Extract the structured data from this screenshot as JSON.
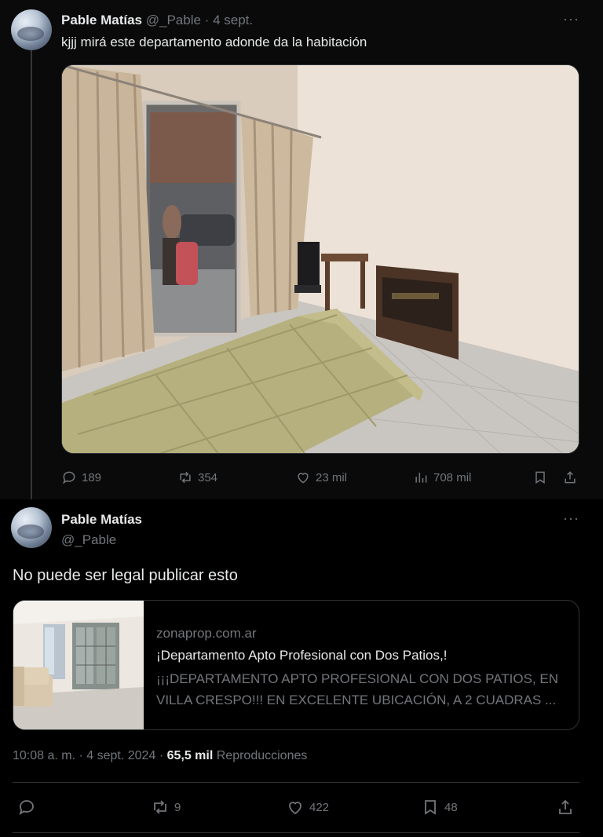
{
  "reply": {
    "author_name": "Pable Matías",
    "author_handle": "@_Pable",
    "separator": "·",
    "date": "4 sept.",
    "more": "···",
    "text": "kjjj mirá este departamento adonde da la habitación",
    "stats": {
      "replies": "189",
      "reposts": "354",
      "likes": "23 mil",
      "views": "708 mil"
    }
  },
  "main": {
    "author_name": "Pable Matías",
    "author_handle": "@_Pable",
    "more": "···",
    "text": "No puede ser legal publicar esto",
    "card": {
      "domain": "zonaprop.com.ar",
      "title": "¡Departamento Apto Profesional con Dos Patios,!",
      "description": "¡¡¡DEPARTAMENTO APTO PROFESIONAL CON DOS PATIOS, EN VILLA CRESPO!!! EN EXCELENTE UBICACIÓN, A 2 CUADRAS ..."
    },
    "meta": {
      "time": "10:08 a. m.",
      "separator1": "·",
      "date": "4 sept. 2024",
      "separator2": "·",
      "views": "65,5 mil",
      "views_label": "Reproducciones"
    },
    "stats": {
      "reposts": "9",
      "likes": "422",
      "bookmarks": "48"
    }
  },
  "icons": {
    "reply": "reply-icon",
    "repost": "repost-icon",
    "like": "heart-icon",
    "views": "views-chart-icon",
    "bookmark": "bookmark-icon",
    "share": "share-icon"
  },
  "colors": {
    "background": "#000000",
    "text": "#e7e9ea",
    "muted": "#71767b",
    "border": "#2f3336"
  }
}
